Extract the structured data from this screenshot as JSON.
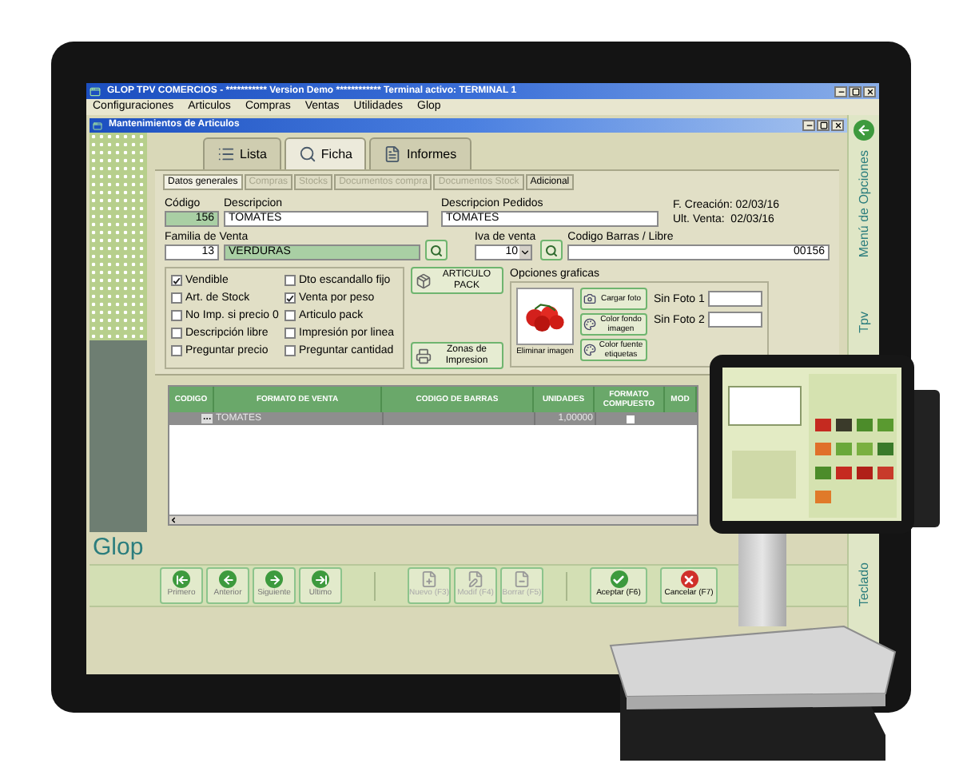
{
  "window": {
    "title": "GLOP TPV COMERCIOS - *********** Version Demo ************ Terminal activo: TERMINAL 1"
  },
  "menu": [
    "Configuraciones",
    "Articulos",
    "Compras",
    "Ventas",
    "Utilidades",
    "Glop"
  ],
  "child_window": {
    "title": "Mantenimientos de Articulos"
  },
  "main_tabs": [
    {
      "label": "Lista",
      "selected": false
    },
    {
      "label": "Ficha",
      "selected": true
    },
    {
      "label": "Informes",
      "selected": false
    }
  ],
  "sub_tabs": [
    {
      "label": "Datos generales",
      "selected": true,
      "disabled": false
    },
    {
      "label": "Compras",
      "selected": false,
      "disabled": true
    },
    {
      "label": "Stocks",
      "selected": false,
      "disabled": true
    },
    {
      "label": "Documentos compra",
      "selected": false,
      "disabled": true
    },
    {
      "label": "Documentos Stock",
      "selected": false,
      "disabled": true
    },
    {
      "label": "Adicional",
      "selected": false,
      "disabled": false
    }
  ],
  "form": {
    "codigo": {
      "label": "Código",
      "value": "156"
    },
    "descripcion": {
      "label": "Descripcion",
      "value": "TOMATES"
    },
    "descripcion_pedidos": {
      "label": "Descripcion Pedidos",
      "value": "TOMATES"
    },
    "fecha_creacion": "F. Creación: 02/03/16",
    "ult_venta": "Ult. Venta:  02/03/16",
    "familia": {
      "label": "Familia de Venta",
      "code": "13",
      "name": "VERDURAS"
    },
    "iva": {
      "label": "Iva de venta",
      "value": "10"
    },
    "codigo_barras": {
      "label": "Codigo Barras / Libre",
      "value": "00156"
    }
  },
  "options": [
    {
      "label": "Vendible",
      "checked": true
    },
    {
      "label": "Dto escandallo fijo",
      "checked": false
    },
    {
      "label": "Art. de Stock",
      "checked": false
    },
    {
      "label": "Venta por peso",
      "checked": true
    },
    {
      "label": "No Imp. si precio 0",
      "checked": false
    },
    {
      "label": "Articulo pack",
      "checked": false
    },
    {
      "label": "Descripción libre",
      "checked": false
    },
    {
      "label": "Impresión por linea",
      "checked": false
    },
    {
      "label": "Preguntar precio",
      "checked": false
    },
    {
      "label": "Preguntar cantidad",
      "checked": false
    }
  ],
  "article_buttons": [
    {
      "label": "ARTICULO PACK",
      "kind": "pack"
    },
    {
      "label": "Zonas de Impresion",
      "kind": "print"
    }
  ],
  "graphic_options": {
    "title": "Opciones graficas",
    "remove_image": "Eliminar imagen",
    "buttons": [
      {
        "label": "Cargar foto",
        "kind": "photo"
      },
      {
        "label": "Color fondo imagen",
        "kind": "color"
      },
      {
        "label": "Color fuente etiquetas",
        "kind": "color"
      }
    ],
    "photo_fields": [
      "Sin Foto 1",
      "Sin Foto 2"
    ]
  },
  "table": {
    "columns": [
      "CODIGO",
      "FORMATO DE VENTA",
      "CODIGO DE BARRAS",
      "UNIDADES",
      "FORMATO COMPUESTO",
      "MOD"
    ],
    "rows": [
      {
        "formato_de_venta": "TOMATES",
        "unidades": "1,00000",
        "formato_compuesto": false,
        "selected": true
      }
    ]
  },
  "brand": "Glop",
  "navigation": [
    {
      "label": "Primero",
      "kind": "first",
      "disabled": false
    },
    {
      "label": "Anterior",
      "kind": "prev",
      "disabled": false
    },
    {
      "label": "Siguiente",
      "kind": "next",
      "disabled": false
    },
    {
      "label": "Ultimo",
      "kind": "last",
      "disabled": false
    }
  ],
  "record_buttons": [
    {
      "label": "Nuevo (F3)",
      "kind": "new",
      "disabled": true
    },
    {
      "label": "Modif (F4)",
      "kind": "edit",
      "disabled": true
    },
    {
      "label": "Borrar (F5)",
      "kind": "delete",
      "disabled": true
    }
  ],
  "confirm_buttons": [
    {
      "label": "Aceptar (F6)",
      "kind": "accept"
    },
    {
      "label": "Cancelar (F7)",
      "kind": "cancel"
    }
  ],
  "side_panel": [
    "Menú de Opciones",
    "Tpv",
    "Teclado"
  ]
}
